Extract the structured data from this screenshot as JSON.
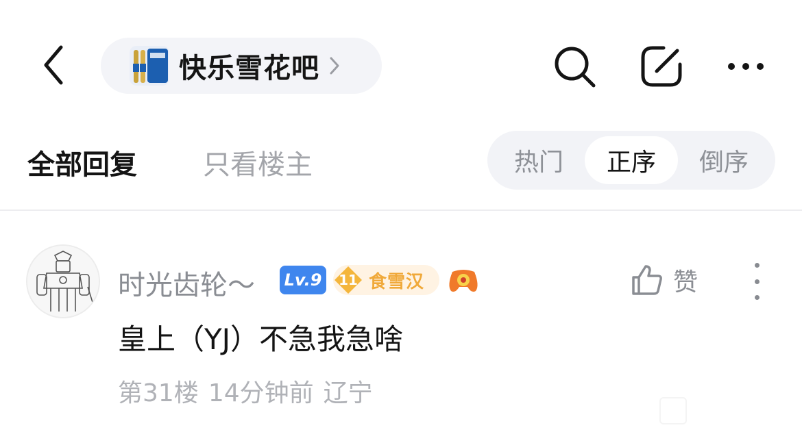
{
  "header": {
    "forum_name": "快乐雪花吧",
    "back_icon": "chevron-left-icon",
    "search_icon": "search-icon",
    "edit_icon": "edit-icon",
    "more_icon": "more-horizontal-icon"
  },
  "filters": {
    "tabs": [
      "全部回复",
      "只看楼主"
    ],
    "sort_options": [
      "热门",
      "正序",
      "倒序"
    ],
    "selected_sort": "正序"
  },
  "post": {
    "username": "时光齿轮～",
    "level_badge": "Lv.9",
    "fan_level": "11",
    "fan_title": "食雪汉",
    "like_label": "赞",
    "content": "皇上（YJ）不急我急啥",
    "floor": "第31楼",
    "time": "14分钟前",
    "location": "辽宁"
  },
  "colors": {
    "accent_blue": "#3f86ee",
    "fan_gold": "#f0a93a",
    "pill_bg": "#f3f4f8",
    "muted_text": "#8a8d93"
  }
}
